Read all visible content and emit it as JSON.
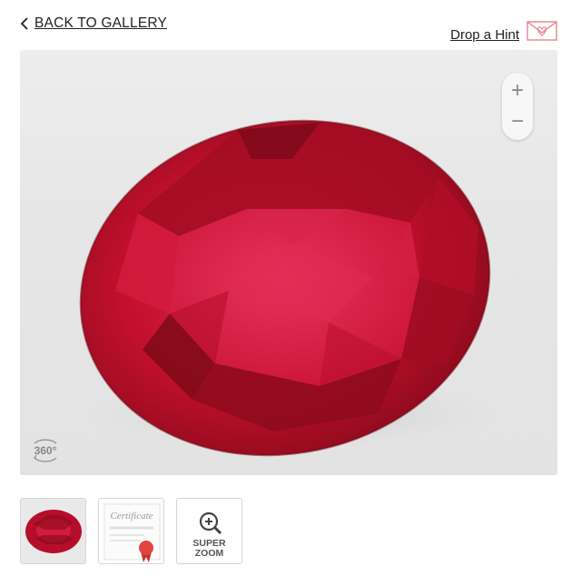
{
  "nav": {
    "back_label": "BACK TO GALLERY",
    "hint_label": "Drop a Hint"
  },
  "viewer": {
    "zoom_in": "+",
    "zoom_out": "−",
    "spin_label": "360°"
  },
  "thumbnails": {
    "certificate_label": "Certificate",
    "superzoom_line1": "SUPER",
    "superzoom_line2": "ZOOM"
  },
  "colors": {
    "gem_primary": "#c8102e",
    "gem_dark": "#7a0a18",
    "accent_hint": "#e8828a"
  },
  "icons": [
    "chevron-left-icon",
    "envelope-heart-icon",
    "zoom-in-icon",
    "zoom-out-icon",
    "rotate-360-icon",
    "magnifier-plus-icon",
    "ribbon-seal-icon"
  ]
}
